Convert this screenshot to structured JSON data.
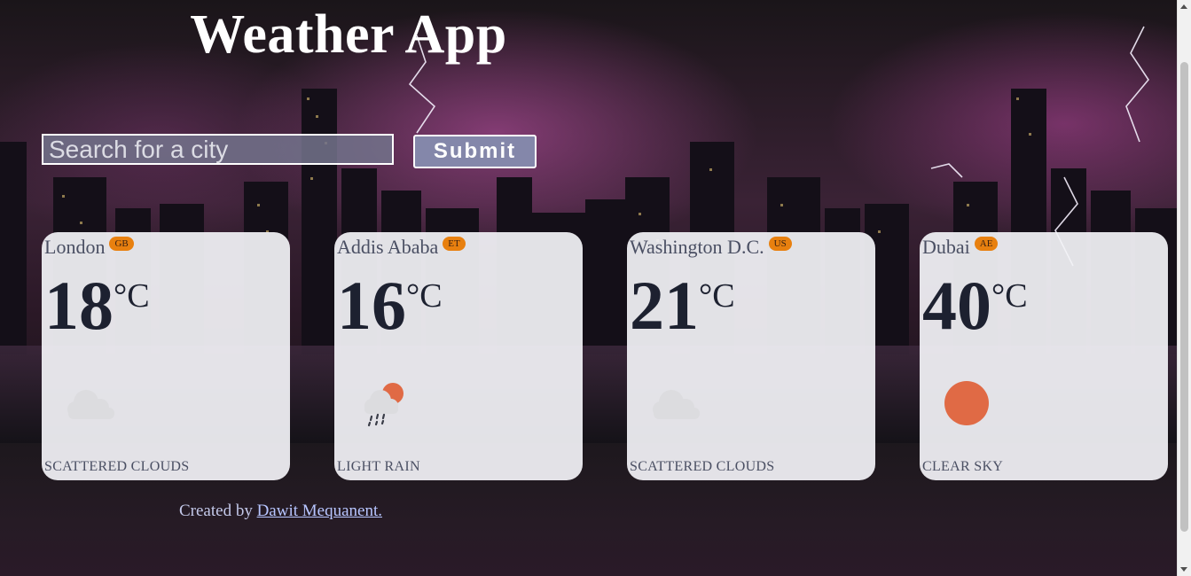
{
  "header": {
    "title": "Weather App"
  },
  "search": {
    "placeholder": "Search for a city",
    "submit_label": "Submit"
  },
  "cards": [
    {
      "city": "London",
      "country": "GB",
      "temp": "18",
      "unit": "°C",
      "description": "scattered clouds",
      "icon": "cloud-icon"
    },
    {
      "city": "Addis Ababa",
      "country": "ET",
      "temp": "16",
      "unit": "°C",
      "description": "light rain",
      "icon": "sun-rain-cloud-icon"
    },
    {
      "city": "Washington D.C.",
      "country": "US",
      "temp": "21",
      "unit": "°C",
      "description": "scattered clouds",
      "icon": "cloud-icon"
    },
    {
      "city": "Dubai",
      "country": "AE",
      "temp": "40",
      "unit": "°C",
      "description": "clear sky",
      "icon": "sun-icon"
    }
  ],
  "footer": {
    "prefix": "Created by",
    "author": "Dawit Mequanent."
  },
  "colors": {
    "badge": "#e8800f",
    "sun": "#e06a45",
    "submit_bg": "#8487aa"
  }
}
